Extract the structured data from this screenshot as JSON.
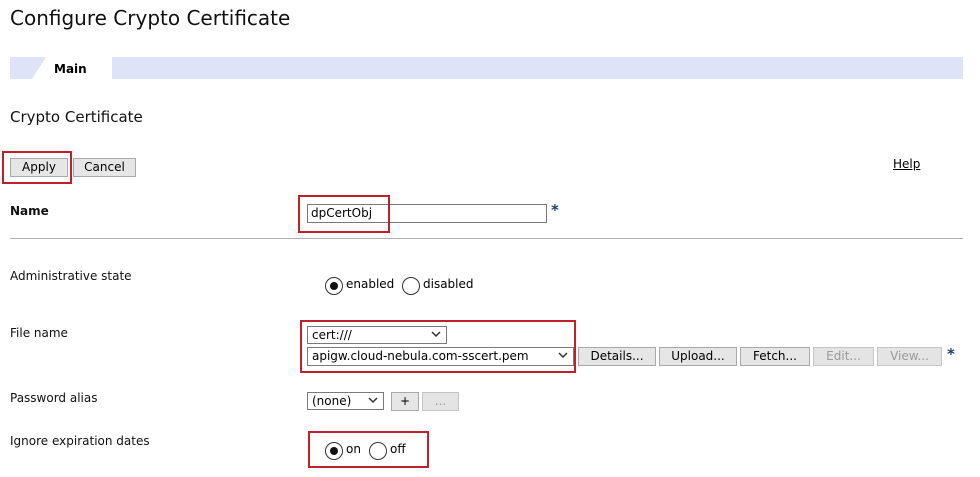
{
  "page": {
    "title": "Configure Crypto Certificate"
  },
  "tabs": [
    {
      "label": "Main"
    }
  ],
  "section": {
    "title": "Crypto Certificate"
  },
  "toolbar": {
    "apply": "Apply",
    "cancel": "Cancel",
    "help": "Help"
  },
  "form": {
    "name": {
      "label": "Name",
      "value": "dpCertObj",
      "required_mark": "*"
    },
    "admin_state": {
      "label": "Administrative state",
      "options": [
        "enabled",
        "disabled"
      ],
      "selected": "enabled"
    },
    "file_name": {
      "label": "File name",
      "directory": "cert:///",
      "file": "apigw.cloud-nebula.com-sscert.pem",
      "buttons": {
        "details": "Details...",
        "upload": "Upload...",
        "fetch": "Fetch...",
        "edit": "Edit...",
        "view": "View..."
      },
      "required_mark": "*"
    },
    "password_alias": {
      "label": "Password alias",
      "value": "(none)",
      "add": "+",
      "more": "..."
    },
    "ignore_expiration": {
      "label": "Ignore expiration dates",
      "options": [
        "on",
        "off"
      ],
      "selected": "on"
    }
  },
  "colors": {
    "highlight": "#c0202a",
    "tabbar": "#dfe3f7",
    "required_star": "#1c3a8a"
  }
}
